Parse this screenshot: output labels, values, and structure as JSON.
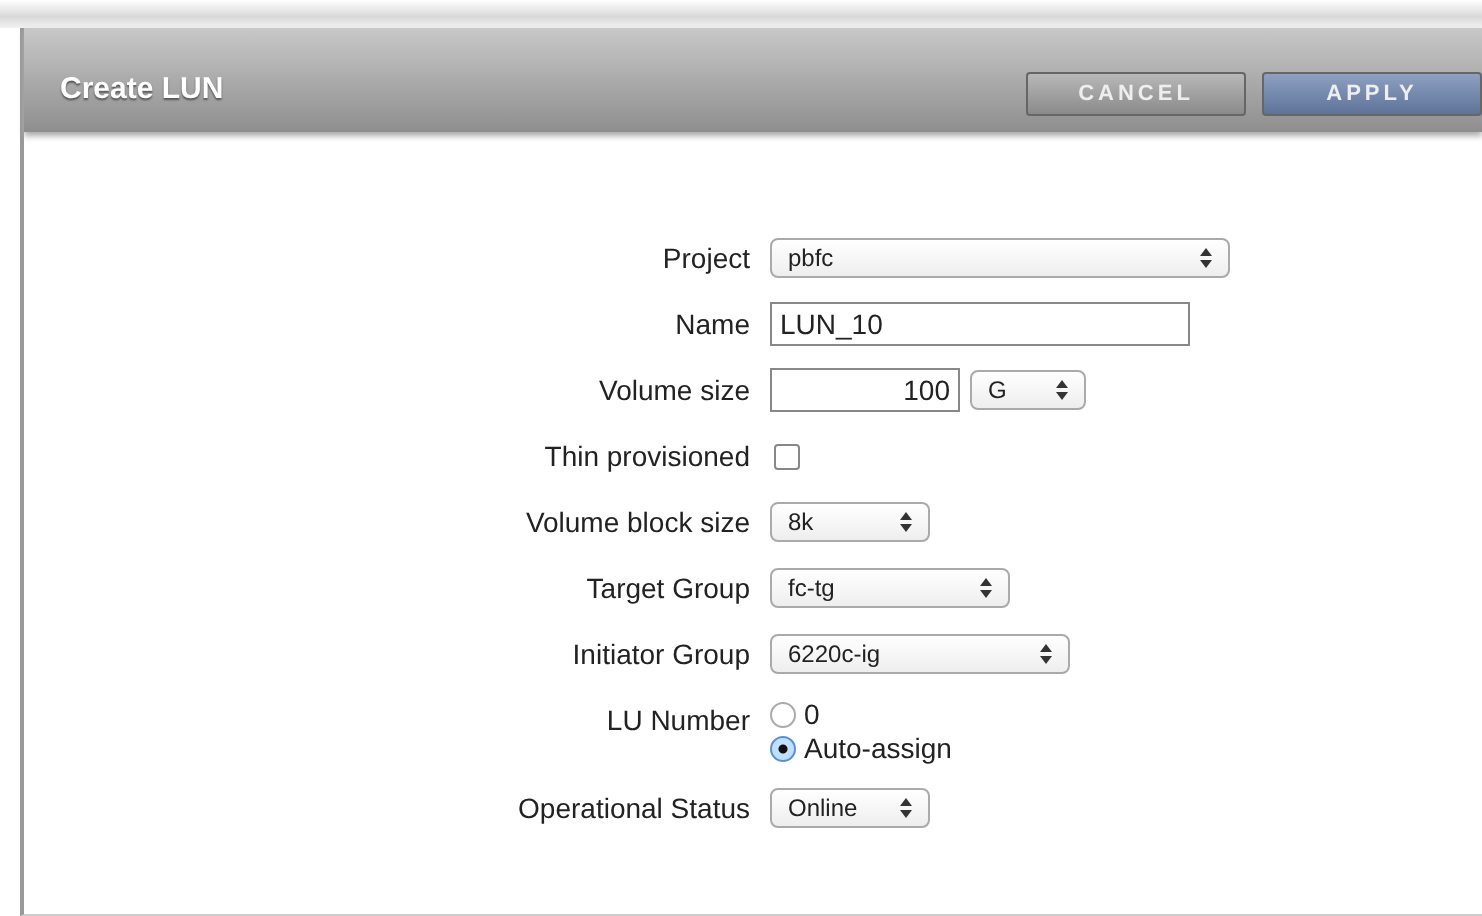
{
  "dialog": {
    "title": "Create LUN",
    "buttons": [
      {
        "label": "CANCEL",
        "kind": "secondary"
      },
      {
        "label": "APPLY",
        "kind": "primary"
      }
    ]
  },
  "fields": [
    {
      "label": "Project",
      "kind": "select",
      "value": "pbfc"
    },
    {
      "label": "Name",
      "kind": "text",
      "value": "LUN_10"
    },
    {
      "label": "Volume size",
      "kind": "size",
      "value": "100",
      "unit": "G"
    },
    {
      "label": "Thin provisioned",
      "kind": "checkbox",
      "checked": false
    },
    {
      "label": "Volume block size",
      "kind": "select",
      "value": "8k"
    },
    {
      "label": "Target Group",
      "kind": "select",
      "value": "fc-tg"
    },
    {
      "label": "Initiator Group",
      "kind": "select",
      "value": "6220c-ig"
    },
    {
      "label": "LU Number",
      "kind": "radio",
      "options": [
        {
          "label": "0",
          "selected": false
        },
        {
          "label": "Auto-assign",
          "selected": true
        }
      ]
    },
    {
      "label": "Operational Status",
      "kind": "select",
      "value": "Online"
    }
  ]
}
